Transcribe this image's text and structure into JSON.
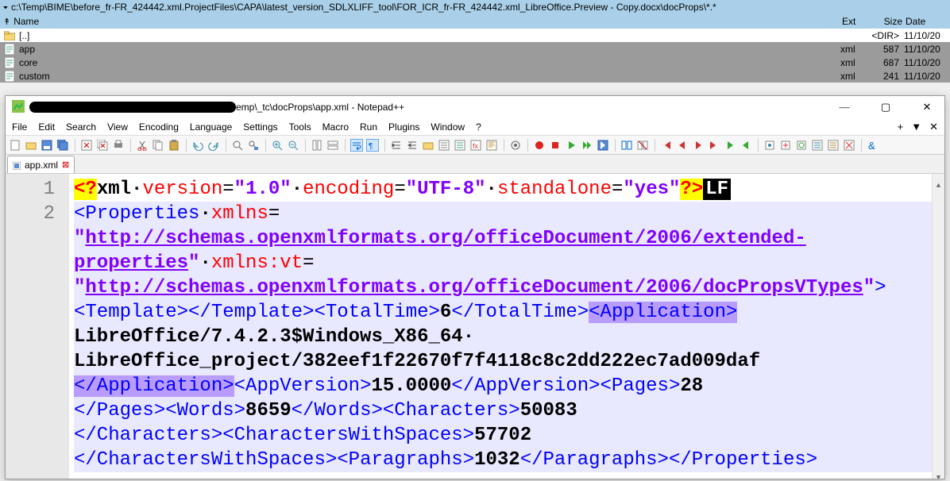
{
  "fm": {
    "path": "c:\\Temp\\BIME\\before_fr-FR_424442.xml.ProjectFiles\\CAPA\\latest_version_SDLXLIFF_tool\\FOR_ICR_fr-FR_424442.xml_LibreOffice.Preview - Copy.docx\\docProps\\*.*",
    "path_arrow": "▾",
    "headers": {
      "name_icon": "↟",
      "name": "Name",
      "ext": "Ext",
      "size": "Size",
      "date": "Date"
    },
    "rows": [
      {
        "icon": "folder",
        "name": "[..]",
        "ext": "",
        "size": "<DIR>",
        "date": "11/10/20",
        "kind": "updir"
      },
      {
        "icon": "file",
        "name": "app",
        "ext": "xml",
        "size": "587",
        "date": "11/10/20",
        "kind": "sel"
      },
      {
        "icon": "file",
        "name": "core",
        "ext": "xml",
        "size": "687",
        "date": "11/10/20",
        "kind": "sel"
      },
      {
        "icon": "file",
        "name": "custom",
        "ext": "xml",
        "size": "241",
        "date": "11/10/20",
        "kind": "sel"
      }
    ]
  },
  "npp": {
    "title_suffix": "emp\\_tc\\docProps\\app.xml - Notepad++",
    "winbtns": {
      "min": "—",
      "max": "▢",
      "close": "✕"
    },
    "menu": [
      "File",
      "Edit",
      "Search",
      "View",
      "Encoding",
      "Language",
      "Settings",
      "Tools",
      "Macro",
      "Run",
      "Plugins",
      "Window",
      "?"
    ],
    "menu_right": {
      "plus": "+",
      "down": "▼",
      "x": "✕"
    },
    "tab": {
      "name": "app.xml",
      "close": "⊠"
    },
    "gutter": [
      "1",
      "2"
    ],
    "xml": {
      "pi_open": "<?",
      "pi_target": "xml",
      "attr_version": "version",
      "val_version": "\"1.0\"",
      "attr_encoding": "encoding",
      "val_encoding": "\"UTF-8\"",
      "attr_standalone": "standalone",
      "val_standalone": "\"yes\"",
      "pi_close": "?>",
      "eol": "LF",
      "props_open": "<Properties",
      "xmlns": "xmlns",
      "eq": "=",
      "ns1a": "\"",
      "ns1_url": "http://schemas.openxmlformats.org/officeDocument/2006/extended-properties",
      "ns1b": "\"",
      "xmlns_vt": "xmlns:vt",
      "ns2a": "\"",
      "ns2_url": "http://schemas.openxmlformats.org/officeDocument/2006/docPropsVTypes",
      "ns2b": "\"",
      "gt": ">",
      "tpl_open": "<Template>",
      "tpl_close": "</Template>",
      "tt_open": "<TotalTime>",
      "tt_val": "6",
      "tt_close": "</TotalTime>",
      "app_open": "<Application>",
      "app_val1": "LibreOffice/7.4.2.3$Windows_X86_64",
      "app_val2": "LibreOffice_project/382eef1f22670f7f4118c8c2dd222ec7ad009daf",
      "app_close": "</Application>",
      "av_open": "<AppVersion>",
      "av_val": "15.0000",
      "av_close": "</AppVersion>",
      "pg_open": "<Pages>",
      "pg_val": "28",
      "pg_close": "</Pages>",
      "wd_open": "<Words>",
      "wd_val": "8659",
      "wd_close": "</Words>",
      "ch_open": "<Characters>",
      "ch_val": "50083",
      "ch_close": "</Characters>",
      "cws_open": "<CharactersWithSpaces>",
      "cws_val": "57702",
      "cws_close": "</CharactersWithSpaces>",
      "par_open": "<Paragraphs>",
      "par_val": "1032",
      "par_close": "</Paragraphs>",
      "props_close": "</Properties>"
    }
  }
}
